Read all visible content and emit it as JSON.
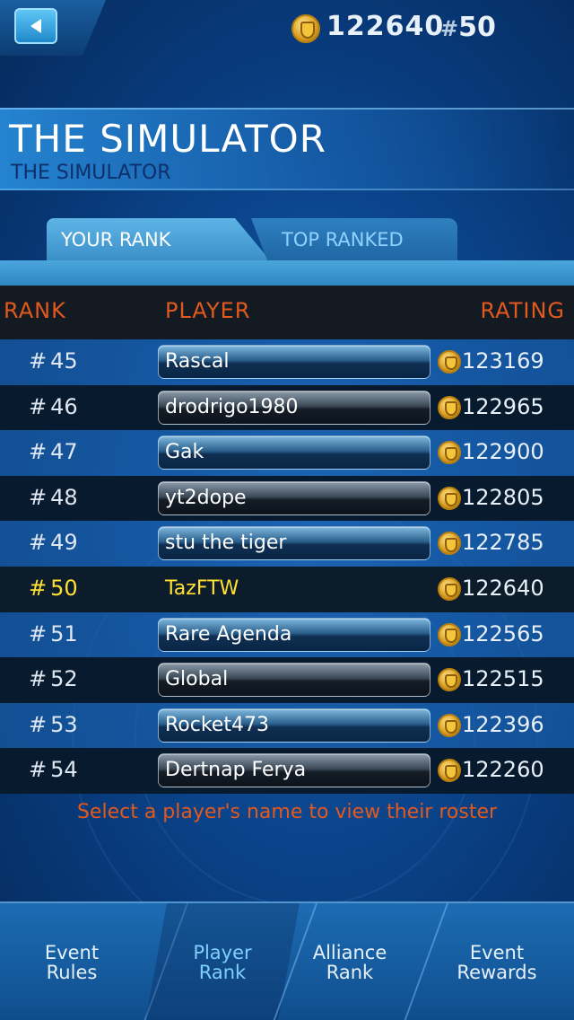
{
  "topbar": {
    "back_icon": "left-arrow-icon",
    "coin_icon": "shield-coin-icon",
    "rating": "122640",
    "rank_hash": "#",
    "rank_value": "50"
  },
  "event": {
    "title": "THE SIMULATOR",
    "subtitle": "THE SIMULATOR"
  },
  "tabs": {
    "your_rank": "YOUR RANK",
    "top_ranked": "TOP RANKED"
  },
  "table": {
    "headers": {
      "rank": "RANK",
      "player": "PLAYER",
      "rating": "RATING"
    },
    "rows": [
      {
        "hash": "#",
        "rank": "45",
        "player": "Rascal",
        "rating": "123169"
      },
      {
        "hash": "#",
        "rank": "46",
        "player": "drodrigo1980",
        "rating": "122965"
      },
      {
        "hash": "#",
        "rank": "47",
        "player": "Gak",
        "rating": "122900"
      },
      {
        "hash": "#",
        "rank": "48",
        "player": "yt2dope",
        "rating": "122805"
      },
      {
        "hash": "#",
        "rank": "49",
        "player": "stu the tiger",
        "rating": "122785"
      },
      {
        "hash": "#",
        "rank": "50",
        "player": "TazFTW",
        "rating": "122640"
      },
      {
        "hash": "#",
        "rank": "51",
        "player": "Rare Agenda",
        "rating": "122565"
      },
      {
        "hash": "#",
        "rank": "52",
        "player": "Global",
        "rating": "122515"
      },
      {
        "hash": "#",
        "rank": "53",
        "player": "Rocket473",
        "rating": "122396"
      },
      {
        "hash": "#",
        "rank": "54",
        "player": "Dertnap Ferya",
        "rating": "122260"
      }
    ]
  },
  "hint": "Select a player's name to view their roster",
  "nav": [
    {
      "line1": "Event",
      "line2": "Rules"
    },
    {
      "line1": "Player",
      "line2": "Rank"
    },
    {
      "line1": "Alliance",
      "line2": "Rank"
    },
    {
      "line1": "Event",
      "line2": "Rewards"
    }
  ],
  "colors": {
    "accent_orange": "#e2591e",
    "highlight_yellow": "#ffe033",
    "active_tab_text": "#7fd0ff"
  }
}
